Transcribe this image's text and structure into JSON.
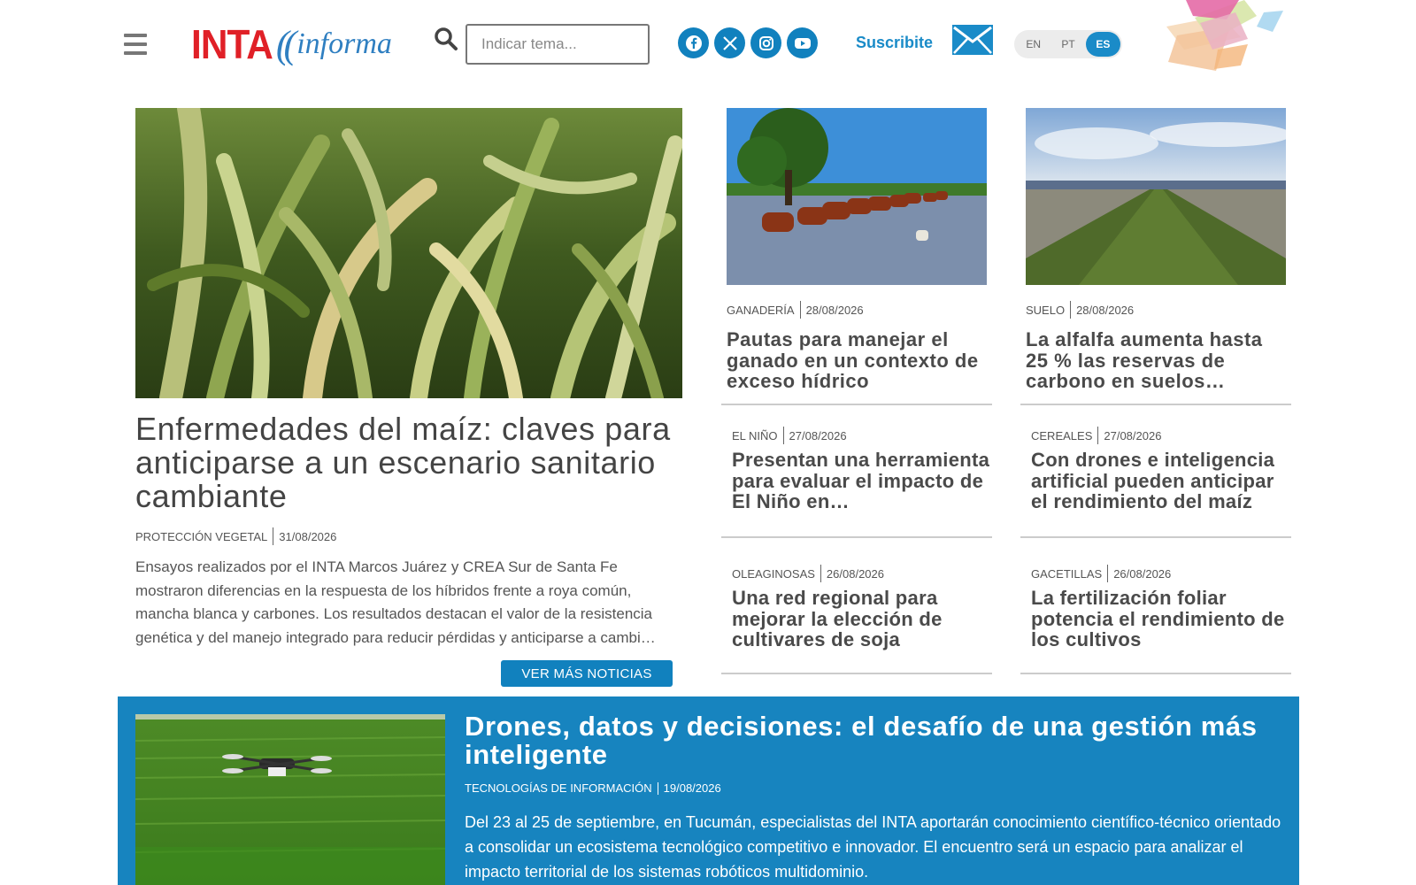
{
  "header": {
    "logo_brand": "INTA",
    "logo_suffix": "informa",
    "search_placeholder": "Indicar tema...",
    "subscribe_label": "Suscribite",
    "social_icons": [
      "facebook-icon",
      "x-icon",
      "instagram-icon",
      "youtube-icon"
    ],
    "languages": [
      {
        "code": "EN",
        "active": false
      },
      {
        "code": "PT",
        "active": false
      },
      {
        "code": "ES",
        "active": true
      }
    ],
    "accent_color": "#1181be",
    "logo_color": "#e02027"
  },
  "main_story": {
    "title": "Enfermedades del maíz: claves para anticiparse a un escenario sanitario cambiante",
    "category": "PROTECCIÓN VEGETAL",
    "date": "31/08/2026",
    "excerpt": "Ensayos realizados por el INTA Marcos Juárez y CREA Sur de Santa Fe mostraron diferencias en la respuesta de los híbridos frente a roya común, mancha blanca y carbones. Los resultados destacan el valor de la resistencia genética y del manejo integrado para reducir pérdidas y anticiparse a cambi…",
    "more_button": "VER MÁS NOTICIAS"
  },
  "side_stories": [
    {
      "category": "GANADERÍA",
      "date": "28/08/2026",
      "title": "Pautas para manejar el ganado en un contexto de exceso hídrico"
    },
    {
      "category": "SUELO",
      "date": "28/08/2026",
      "title": "La alfalfa aumenta hasta 25 % las reservas de carbono en suelos…"
    },
    {
      "category": "EL NIÑO",
      "date": "27/08/2026",
      "title": "Presentan una herramienta para evaluar el impacto de El Niño en…"
    },
    {
      "category": "CEREALES",
      "date": "27/08/2026",
      "title": "Con drones e inteligencia artificial pueden anticipar el rendimiento del maíz"
    },
    {
      "category": "OLEAGINOSAS",
      "date": "26/08/2026",
      "title": "Una red regional para mejorar la elección de cultivares de soja"
    },
    {
      "category": "GACETILLAS",
      "date": "26/08/2026",
      "title": "La fertilización foliar potencia el rendimiento de los cultivos"
    }
  ],
  "featured": {
    "title": "Drones, datos y decisiones: el desafío de una gestión más inteligente",
    "category": "TECNOLOGÍAS DE INFORMACIÓN",
    "date": "19/08/2026",
    "excerpt": "Del 23 al 25 de septiembre, en Tucumán, especialistas del INTA aportarán conocimiento científico-técnico orientado a consolidar un ecosistema tecnológico competitivo e innovador. El encuentro será un espacio para analizar el impacto territorial de los sistemas robóticos multidominio.",
    "band_color": "#1784bf"
  }
}
